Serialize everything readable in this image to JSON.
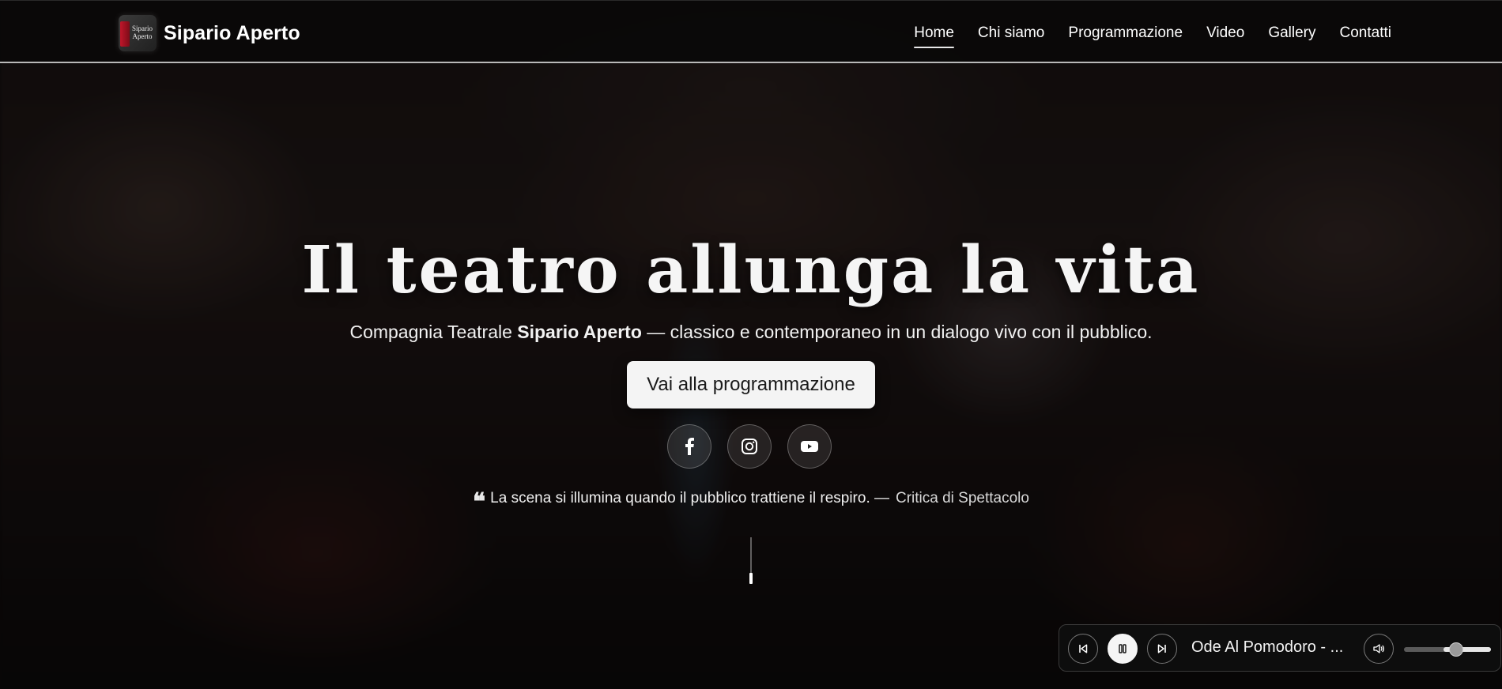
{
  "brand": {
    "logo_text": "Sipario Aperto",
    "name": "Sipario Aperto"
  },
  "nav": {
    "items": [
      {
        "label": "Home",
        "active": true
      },
      {
        "label": "Chi siamo",
        "active": false
      },
      {
        "label": "Programmazione",
        "active": false
      },
      {
        "label": "Video",
        "active": false
      },
      {
        "label": "Gallery",
        "active": false
      },
      {
        "label": "Contatti",
        "active": false
      }
    ]
  },
  "hero": {
    "title": "Il teatro allunga la vita",
    "subtitle_prefix": "Compagnia Teatrale ",
    "subtitle_bold": "Sipario Aperto",
    "subtitle_suffix": " — classico e contemporaneo in un dialogo vivo con il pubblico.",
    "cta_label": "Vai alla programmazione",
    "socials": [
      "facebook-icon",
      "instagram-icon",
      "youtube-icon"
    ],
    "quote_text": "La scena si illumina quando il pubblico trattiene il respiro. —",
    "quote_author": "Critica di Spettacolo"
  },
  "player": {
    "track_title": "Ode Al Pomodoro - ...",
    "state": "playing",
    "volume": 0.6,
    "icons": [
      "previous-icon",
      "pause-icon",
      "next-icon",
      "volume-icon"
    ]
  }
}
